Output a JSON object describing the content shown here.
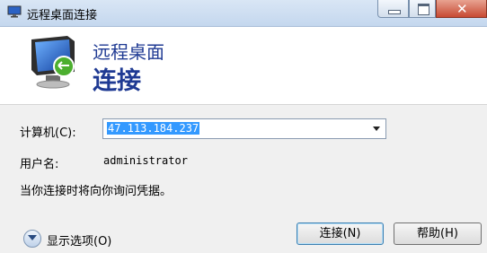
{
  "window": {
    "title": "远程桌面连接",
    "controls": {
      "minimize_icon": "minimize-icon",
      "maximize_icon": "maximize-icon",
      "close_icon": "close-icon"
    }
  },
  "header": {
    "line1": "远程桌面",
    "line2": "连接",
    "icon": "remote-desktop-monitor-icon"
  },
  "form": {
    "computer_label": "计算机(C):",
    "computer_value": "47.113.184.237",
    "username_label": "用户名:",
    "username_value": "administrator",
    "note": "当你连接时将向你询问凭据。"
  },
  "footer": {
    "options_label": "显示选项(O)",
    "connect_label": "连接(N)",
    "help_label": "帮助(H)"
  },
  "colors": {
    "accent": "#1f3a93",
    "selection": "#3399ff"
  }
}
